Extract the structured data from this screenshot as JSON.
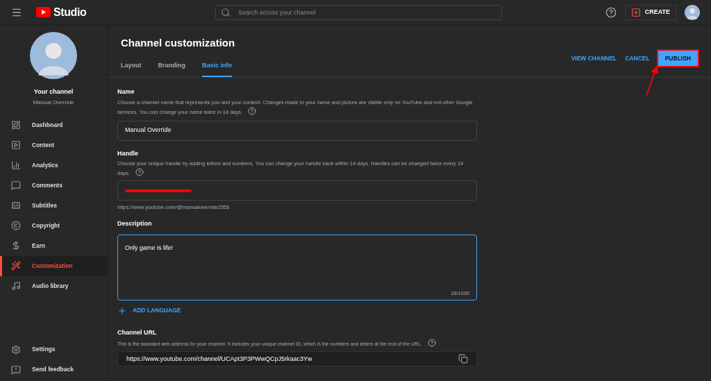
{
  "header": {
    "logo_text": "Studio",
    "search": {
      "placeholder": "Search across your channel"
    },
    "create_button": "CREATE"
  },
  "sidebar": {
    "channel_title": "Your channel",
    "channel_name": "Manual Override",
    "items": [
      {
        "label": "Dashboard",
        "selected": false
      },
      {
        "label": "Content",
        "selected": false
      },
      {
        "label": "Analytics",
        "selected": false
      },
      {
        "label": "Comments",
        "selected": false
      },
      {
        "label": "Subtitles",
        "selected": false
      },
      {
        "label": "Copyright",
        "selected": false
      },
      {
        "label": "Earn",
        "selected": false
      },
      {
        "label": "Customization",
        "selected": true
      },
      {
        "label": "Audio library",
        "selected": false
      }
    ],
    "bottom_items": [
      {
        "label": "Settings"
      },
      {
        "label": "Send feedback"
      }
    ]
  },
  "page": {
    "title": "Channel customization",
    "tabs": [
      {
        "label": "Layout",
        "selected": false
      },
      {
        "label": "Branding",
        "selected": false
      },
      {
        "label": "Basic info",
        "selected": true
      }
    ],
    "actions": [
      {
        "label": "VIEW CHANNEL",
        "kind": "text"
      },
      {
        "label": "CANCEL",
        "kind": "text"
      },
      {
        "label": "PUBLISH",
        "kind": "filled",
        "highlighted": true
      }
    ]
  },
  "name": {
    "label": "Name",
    "description": "Choose a channel name that represents you and your content. Changes made to your name and picture are visible only on YouTube and not other Google services. You can change your name twice in 14 days.",
    "value": "Manual Override"
  },
  "handle": {
    "label": "Handle",
    "description": "Choose your unique handle by adding letters and numbers. You can change your handle back within 14 days. Handles can be changed twice every 14 days.",
    "redacted": true,
    "url": "https://www.youtube.com/@manualoverride2556"
  },
  "description": {
    "label": "Description",
    "value": "Only game is life!",
    "counter": "18/1000",
    "focused": true,
    "add_language": "ADD LANGUAGE"
  },
  "channel_url": {
    "label": "Channel URL",
    "description": "This is the standard web address for your channel. It includes your unique channel ID, which is the numbers and letters at the end of the URL.",
    "value": "https://www.youtube.com/channel/UCApt3P3PWwQCpJ5rkaac3Yw"
  }
}
